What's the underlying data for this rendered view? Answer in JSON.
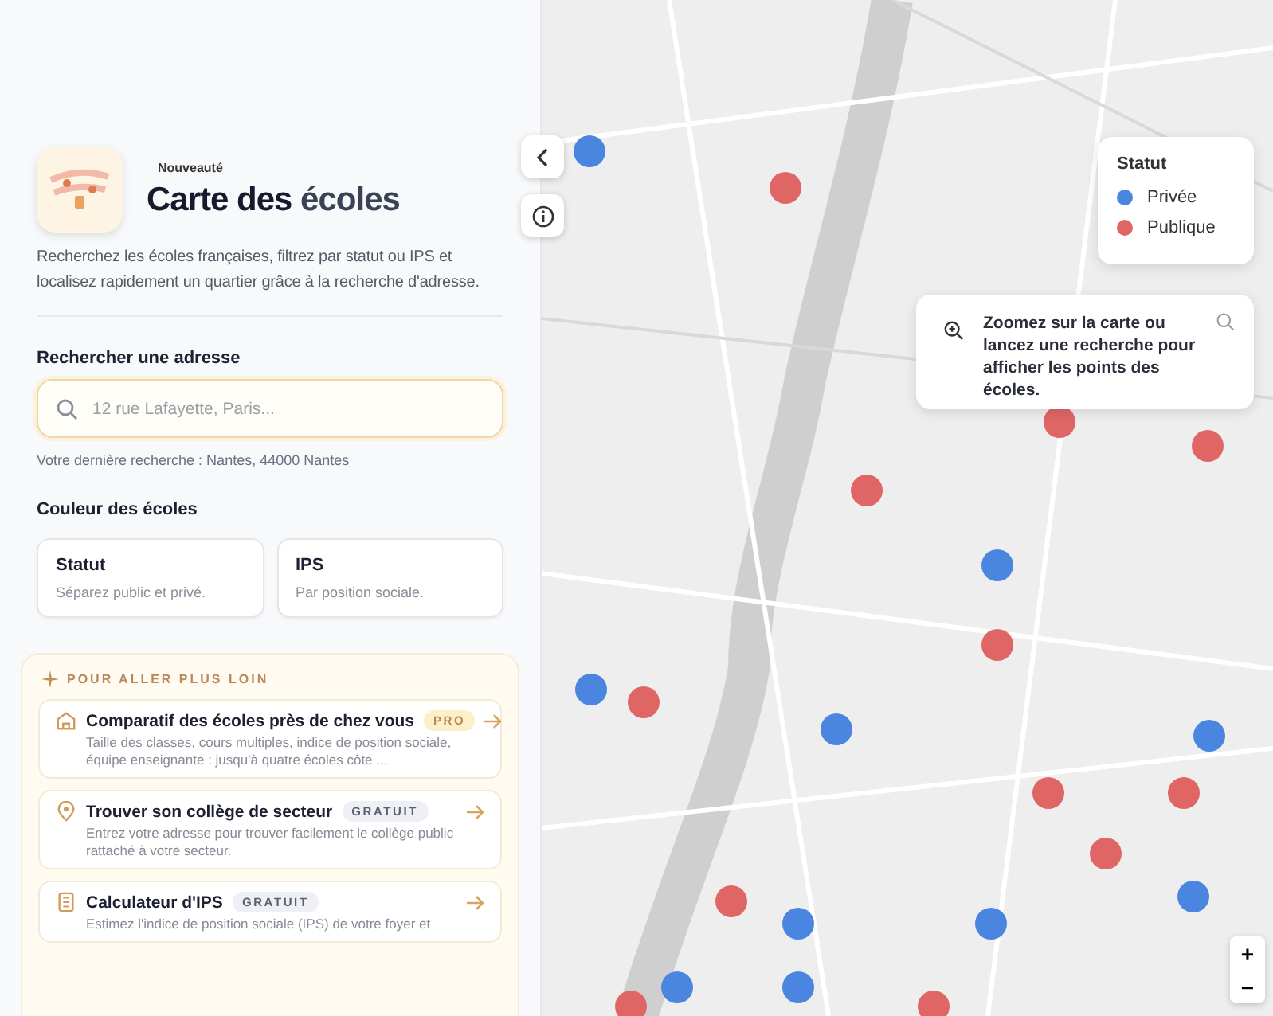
{
  "header": {
    "badge": "Nouveauté",
    "title": {
      "main": "Carte des",
      "accent": "écoles"
    },
    "description": "Recherchez les écoles françaises, filtrez par statut ou IPS et localisez rapidement un quartier grâce à la recherche d'adresse."
  },
  "search": {
    "label": "Rechercher une adresse",
    "placeholder": "12 rue Lafayette, Paris...",
    "last_search": "Votre dernière recherche : Nantes, 44000 Nantes"
  },
  "color_mode": {
    "label": "Couleur des écoles",
    "options": [
      {
        "title": "Statut",
        "subtitle": "Séparez public et privé.",
        "selected": false
      },
      {
        "title": "IPS",
        "subtitle": "Par position sociale.",
        "selected": false
      }
    ]
  },
  "more": {
    "heading": "POUR ALLER PLUS LOIN",
    "items": [
      {
        "kind": "compare",
        "title": "Comparatif des écoles près de chez vous",
        "tag": "PRO",
        "description": "Taille des classes, cours multiples, indice de position sociale, équipe enseignante : jusqu'à quatre écoles côte ..."
      },
      {
        "kind": "pin",
        "title": "Trouver son collège de secteur",
        "tag": "GRATUIT",
        "description": "Entrez votre adresse pour trouver facilement le collège public rattaché à votre secteur."
      },
      {
        "kind": "calculator",
        "title": "Calculateur d'IPS",
        "tag": "GRATUIT",
        "description": "Estimez l'indice de position sociale (IPS) de votre foyer et"
      }
    ]
  },
  "map": {
    "legend": {
      "title": "Statut",
      "items": [
        {
          "label": "Privée",
          "color": "#4a86e0"
        },
        {
          "label": "Publique",
          "color": "#e06666"
        }
      ]
    },
    "hint": "Zoomez sur la carte ou lancez une recherche pour afficher les points des écoles.",
    "zoom_in": "+",
    "zoom_out": "−"
  }
}
